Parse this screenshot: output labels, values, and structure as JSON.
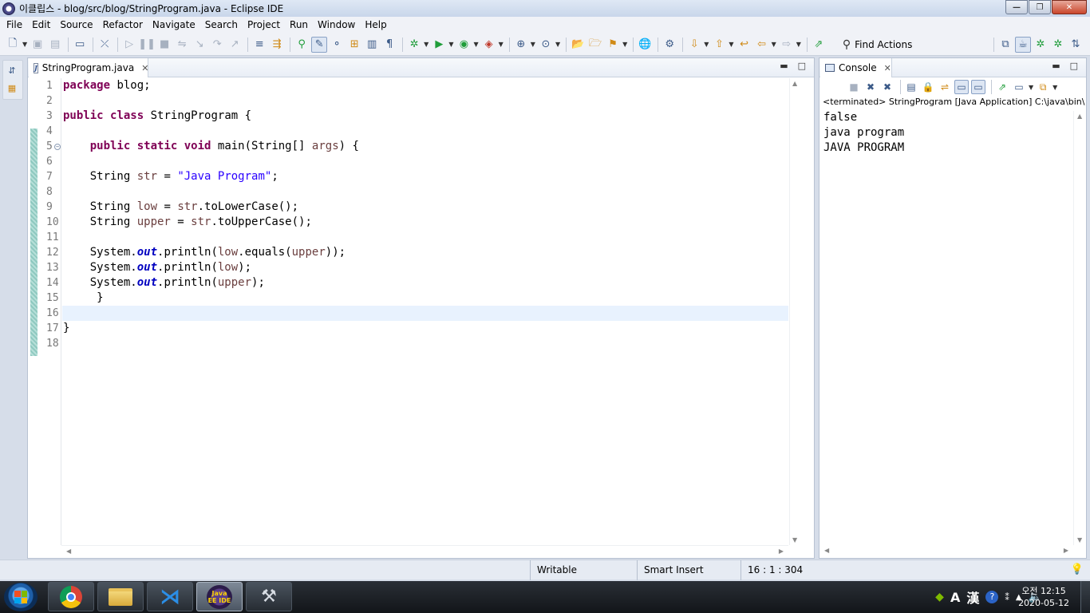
{
  "window": {
    "title": "이클립스 - blog/src/blog/StringProgram.java - Eclipse IDE",
    "controls": [
      "minimize",
      "maximize",
      "close"
    ]
  },
  "menu": [
    "File",
    "Edit",
    "Source",
    "Refactor",
    "Navigate",
    "Search",
    "Project",
    "Run",
    "Window",
    "Help"
  ],
  "toolbar": {
    "find_actions": "Find Actions"
  },
  "editor": {
    "tab_label": "StringProgram.java",
    "line_numbers": [
      "1",
      "2",
      "3",
      "4",
      "5",
      "6",
      "7",
      "8",
      "9",
      "10",
      "11",
      "12",
      "13",
      "14",
      "15",
      "16",
      "17",
      "18"
    ],
    "current_line": 16
  },
  "console": {
    "tab_label": "Console",
    "status": "<terminated> StringProgram [Java Application] C:\\java\\bin\\",
    "output": [
      "false",
      "java program",
      "JAVA PROGRAM"
    ]
  },
  "statusbar": {
    "mode": "Writable",
    "insert": "Smart Insert",
    "position": "16 : 1 : 304"
  },
  "taskbar": {
    "apps": [
      "chrome-icon",
      "explorer-icon",
      "vscode-icon",
      "eclipse-java-ee-icon",
      "tools-icon"
    ],
    "eclipse_label": "Java EE IDE",
    "tray_ime": "A",
    "tray_hanja": "漢",
    "time": "오전 12:15",
    "date": "2020-05-12"
  }
}
